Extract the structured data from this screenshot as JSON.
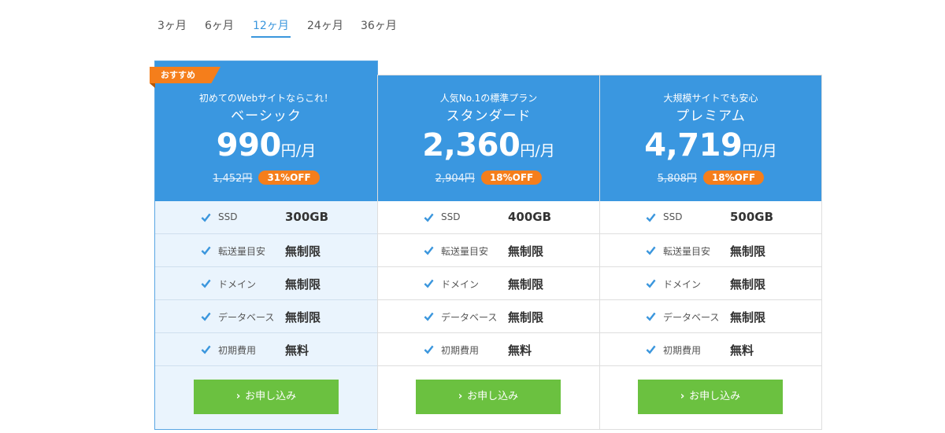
{
  "tabs": [
    {
      "label": "3ヶ月",
      "active": false
    },
    {
      "label": "6ヶ月",
      "active": false
    },
    {
      "label": "12ヶ月",
      "active": true
    },
    {
      "label": "24ヶ月",
      "active": false
    },
    {
      "label": "36ヶ月",
      "active": false
    }
  ],
  "colors": {
    "header_blue": "#3a97e0",
    "accent_blue": "#3a96dd",
    "badge_orange": "#f57e1b",
    "button_green": "#6bc140",
    "featured_bg": "#eaf4fd"
  },
  "plans": [
    {
      "badge": "おすすめ",
      "catch": "初めてのWebサイトならこれ！",
      "name": "ベーシック",
      "price": "990",
      "price_unit": "円/月",
      "old_price": "1,452円",
      "discount": "31%OFF",
      "features": [
        {
          "icon": "check-icon",
          "label": "SSD",
          "value": "300GB"
        },
        {
          "icon": "check-icon",
          "label": "転送量目安",
          "value": "無制限"
        },
        {
          "icon": "check-icon",
          "label": "ドメイン",
          "value": "無制限"
        },
        {
          "icon": "check-icon",
          "label": "データベース",
          "value": "無制限"
        },
        {
          "icon": "check-icon",
          "label": "初期費用",
          "value": "無料"
        }
      ],
      "button": "お申し込み"
    },
    {
      "catch": "人気No.1の標準プラン",
      "name": "スタンダード",
      "price": "2,360",
      "price_unit": "円/月",
      "old_price": "2,904円",
      "discount": "18%OFF",
      "features": [
        {
          "icon": "check-icon",
          "label": "SSD",
          "value": "400GB"
        },
        {
          "icon": "check-icon",
          "label": "転送量目安",
          "value": "無制限"
        },
        {
          "icon": "check-icon",
          "label": "ドメイン",
          "value": "無制限"
        },
        {
          "icon": "check-icon",
          "label": "データベース",
          "value": "無制限"
        },
        {
          "icon": "check-icon",
          "label": "初期費用",
          "value": "無料"
        }
      ],
      "button": "お申し込み"
    },
    {
      "catch": "大規模サイトでも安心",
      "name": "プレミアム",
      "price": "4,719",
      "price_unit": "円/月",
      "old_price": "5,808円",
      "discount": "18%OFF",
      "features": [
        {
          "icon": "check-icon",
          "label": "SSD",
          "value": "500GB"
        },
        {
          "icon": "check-icon",
          "label": "転送量目安",
          "value": "無制限"
        },
        {
          "icon": "check-icon",
          "label": "ドメイン",
          "value": "無制限"
        },
        {
          "icon": "check-icon",
          "label": "データベース",
          "value": "無制限"
        },
        {
          "icon": "check-icon",
          "label": "初期費用",
          "value": "無料"
        }
      ],
      "button": "お申し込み"
    }
  ]
}
